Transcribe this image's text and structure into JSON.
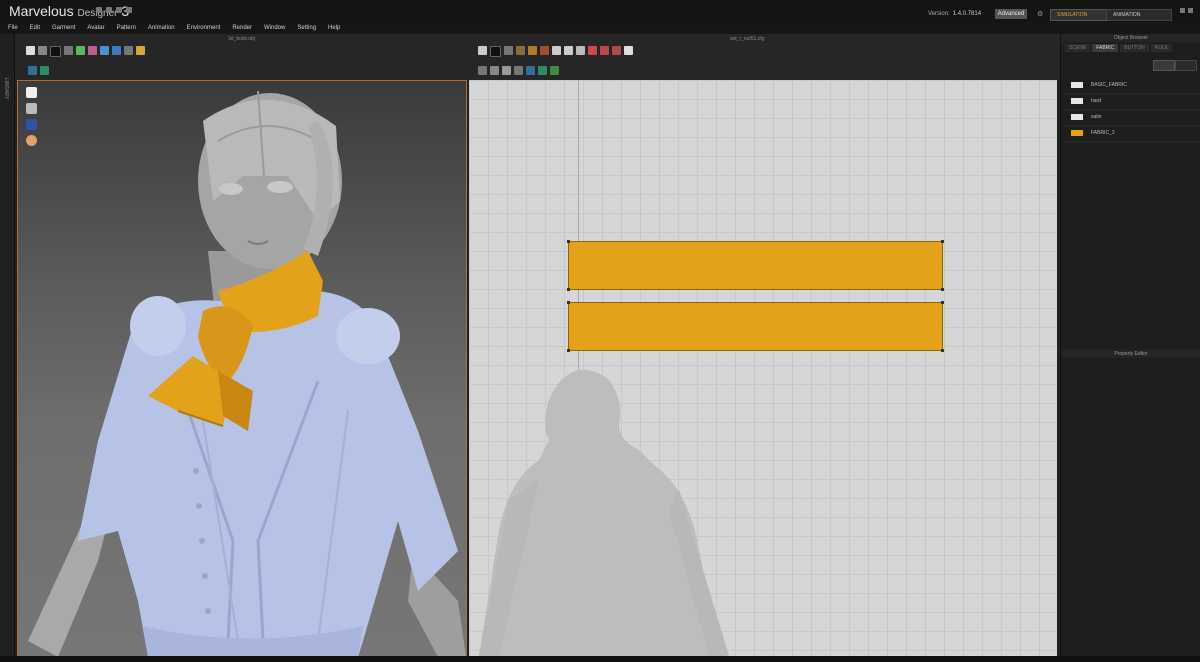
{
  "app": {
    "name": "Marvelous",
    "name_suffix": "Designer",
    "major_version": "3"
  },
  "header": {
    "version_label": "Version:",
    "version_value": "1.4.0.7814",
    "mode_label": "Advanced",
    "simulation_label": "SIMULATION",
    "animation_label": "ANIMATION"
  },
  "menu": [
    "File",
    "Edit",
    "Garment",
    "Avatar",
    "Pattern",
    "Animation",
    "Environment",
    "Render",
    "Window",
    "Setting",
    "Help"
  ],
  "panes": {
    "left_title": "3d_bodv.obj",
    "right_title": "avt_r_out51.zfg"
  },
  "sidebar": {
    "vertical_label": "LIBRARY"
  },
  "object_browser": {
    "title": "Object Browser",
    "tabs": [
      "SCENE",
      "FABRIC",
      "BUTTON",
      "RULE"
    ],
    "active_tab": "FABRIC",
    "fabrics": [
      {
        "name": "BASIC_FABRIC",
        "color": "#e6e6e6"
      },
      {
        "name": "hard",
        "color": "#e6e6e6"
      },
      {
        "name": "satin",
        "color": "#e6e6e6"
      },
      {
        "name": "FABRIC_2",
        "color": "#e2a219"
      }
    ]
  },
  "property_editor": {
    "title": "Property Editor"
  },
  "colors": {
    "accent": "#e2a219",
    "viewport_border": "#b46a2a"
  },
  "icons": {
    "viewport": [
      "shirt-icon",
      "avatar-icon",
      "fabric-icon",
      "face-icon"
    ]
  }
}
